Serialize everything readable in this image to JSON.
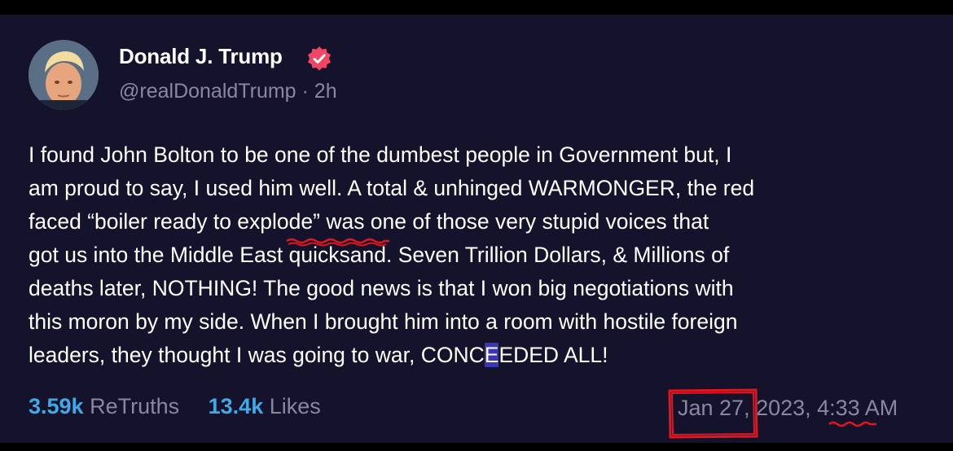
{
  "post": {
    "author": {
      "display_name": "Donald J. Trump",
      "handle_meta": "@realDonaldTrump · 2h",
      "verified_icon": "verified-check-icon",
      "verified_color": "#f04663"
    },
    "body": {
      "line1": "I found John Bolton to be one of the dumbest people in Government but, I",
      "line2": "am proud to say, I used him well. A total & unhinged WARMONGER, the red",
      "line3": "faced “boiler ready to explode” was one of those very stupid voices that",
      "line4": "got us into the Middle East quicksand. Seven Trillion Dollars, & Millions of",
      "line5": "deaths later, NOTHING! The good news is that I won big negotiations with",
      "line6": "this moron by my side. When I brought him into a room with hostile foreign",
      "line7_a": "leaders, they thought I was going to war, CONC",
      "line7_b": "E",
      "line7_c": "EDED ALL!"
    },
    "stats": {
      "retruths_count": "3.59k",
      "retruths_label": "ReTruths",
      "likes_count": "13.4k",
      "likes_label": "Likes"
    },
    "timestamp": "Jan 27, 2023, 4:33 AM"
  },
  "colors": {
    "background": "#15122b",
    "text": "#ffffff",
    "muted": "#8b87a3",
    "stat_accent": "#3eaae8",
    "annotation_red": "#e0151e",
    "highlight": "#3b35b8"
  }
}
